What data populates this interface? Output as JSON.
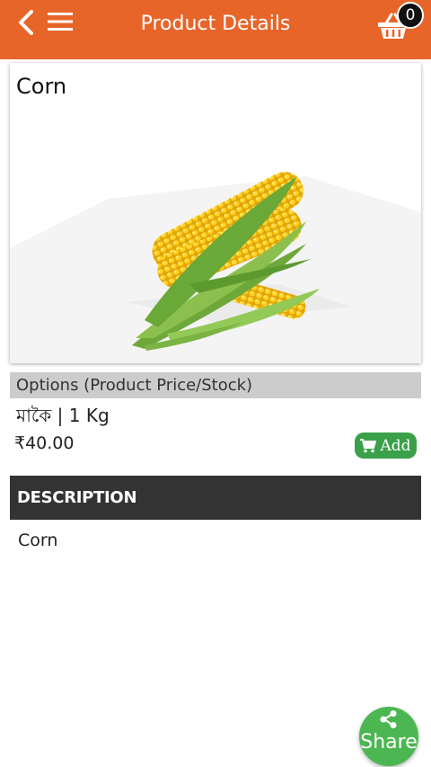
{
  "header": {
    "title": "Product Details",
    "cart_count": "0",
    "icons": [
      "back-arrow-icon",
      "hamburger-menu-icon",
      "cart-basket-icon"
    ]
  },
  "product": {
    "name": "Corn",
    "image": "corn-cobs-image",
    "carousel_pages": 1
  },
  "options": {
    "header": "Options (Product Price/Stock)",
    "variant": "মাকৈ | 1 Kg",
    "price": "₹40.00",
    "add_label": "Add"
  },
  "description": {
    "header": "DESCRIPTION",
    "text": "Corn"
  },
  "share": {
    "label": "Share"
  },
  "colors": {
    "primary": "#e8652a",
    "add_button": "#3aa04a",
    "share_button": "#4cb752",
    "description_header": "#333333",
    "options_header": "#cccccc"
  }
}
